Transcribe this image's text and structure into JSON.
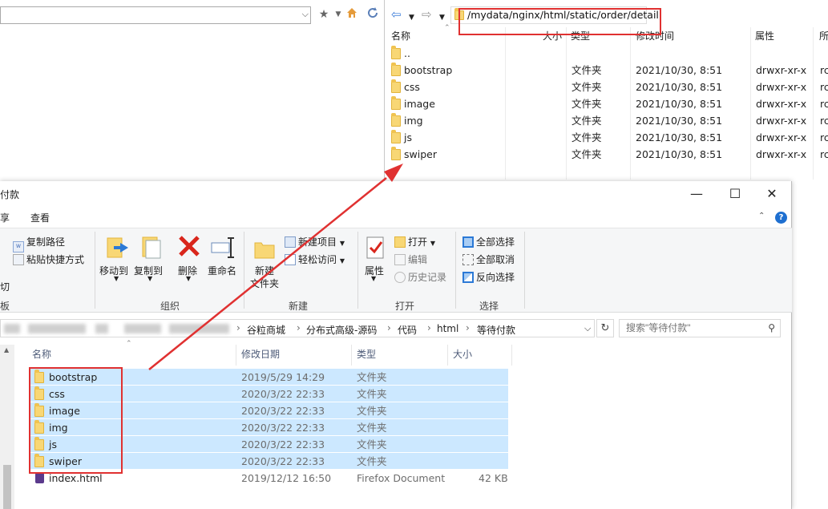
{
  "remote": {
    "path": "/mydata/nginx/html/static/order/detail",
    "columns": [
      "名称",
      "大小",
      "类型",
      "修改时间",
      "属性",
      "所"
    ],
    "rows": [
      {
        "name": "..",
        "type": "",
        "mtime": "",
        "attr": "",
        "owner": ""
      },
      {
        "name": "bootstrap",
        "type": "文件夹",
        "mtime": "2021/10/30, 8:51",
        "attr": "drwxr-xr-x",
        "owner": "rc"
      },
      {
        "name": "css",
        "type": "文件夹",
        "mtime": "2021/10/30, 8:51",
        "attr": "drwxr-xr-x",
        "owner": "rc"
      },
      {
        "name": "image",
        "type": "文件夹",
        "mtime": "2021/10/30, 8:51",
        "attr": "drwxr-xr-x",
        "owner": "rc"
      },
      {
        "name": "img",
        "type": "文件夹",
        "mtime": "2021/10/30, 8:51",
        "attr": "drwxr-xr-x",
        "owner": "rc"
      },
      {
        "name": "js",
        "type": "文件夹",
        "mtime": "2021/10/30, 8:51",
        "attr": "drwxr-xr-x",
        "owner": "rc"
      },
      {
        "name": "swiper",
        "type": "文件夹",
        "mtime": "2021/10/30, 8:51",
        "attr": "drwxr-xr-x",
        "owner": "rc"
      }
    ]
  },
  "explorer": {
    "title": "付款",
    "tabs": [
      "享",
      "查看"
    ],
    "window_controls": {
      "minimize": "—",
      "maximize": "☐",
      "close": "✕"
    },
    "ribbon": {
      "clipboard": {
        "copy_path": "复制路径",
        "paste_shortcut": "粘贴快捷方式",
        "cut": "切",
        "label": "板"
      },
      "organize": {
        "move_to": "移动到",
        "copy_to": "复制到",
        "delete": "删除",
        "rename": "重命名",
        "label": "组织"
      },
      "new": {
        "new_folder_line1": "新建",
        "new_folder_line2": "文件夹",
        "new_item": "新建项目",
        "easy_access": "轻松访问",
        "label": "新建"
      },
      "open": {
        "properties": "属性",
        "open": "打开",
        "edit": "编辑",
        "history": "历史记录",
        "label": "打开"
      },
      "select": {
        "select_all": "全部选择",
        "select_none": "全部取消",
        "invert": "反向选择",
        "label": "选择"
      }
    },
    "breadcrumb": [
      "谷粒商城",
      "分布式高级-源码",
      "代码",
      "html",
      "等待付款"
    ],
    "search_placeholder": "搜索\"等待付款\"",
    "columns": [
      "名称",
      "修改日期",
      "类型",
      "大小"
    ],
    "rows": [
      {
        "name": "bootstrap",
        "date": "2019/5/29 14:29",
        "type": "文件夹",
        "size": "",
        "selected": true
      },
      {
        "name": "css",
        "date": "2020/3/22 22:33",
        "type": "文件夹",
        "size": "",
        "selected": true
      },
      {
        "name": "image",
        "date": "2020/3/22 22:33",
        "type": "文件夹",
        "size": "",
        "selected": true
      },
      {
        "name": "img",
        "date": "2020/3/22 22:33",
        "type": "文件夹",
        "size": "",
        "selected": true
      },
      {
        "name": "js",
        "date": "2020/3/22 22:33",
        "type": "文件夹",
        "size": "",
        "selected": true
      },
      {
        "name": "swiper",
        "date": "2020/3/22 22:33",
        "type": "文件夹",
        "size": "",
        "selected": true
      },
      {
        "name": "index.html",
        "date": "2019/12/12 16:50",
        "type": "Firefox Document",
        "size": "42 KB",
        "selected": false
      }
    ]
  },
  "colors": {
    "highlight_red": "#e03131",
    "selection_blue": "#cce8ff",
    "folder_yellow": "#f8d775"
  }
}
